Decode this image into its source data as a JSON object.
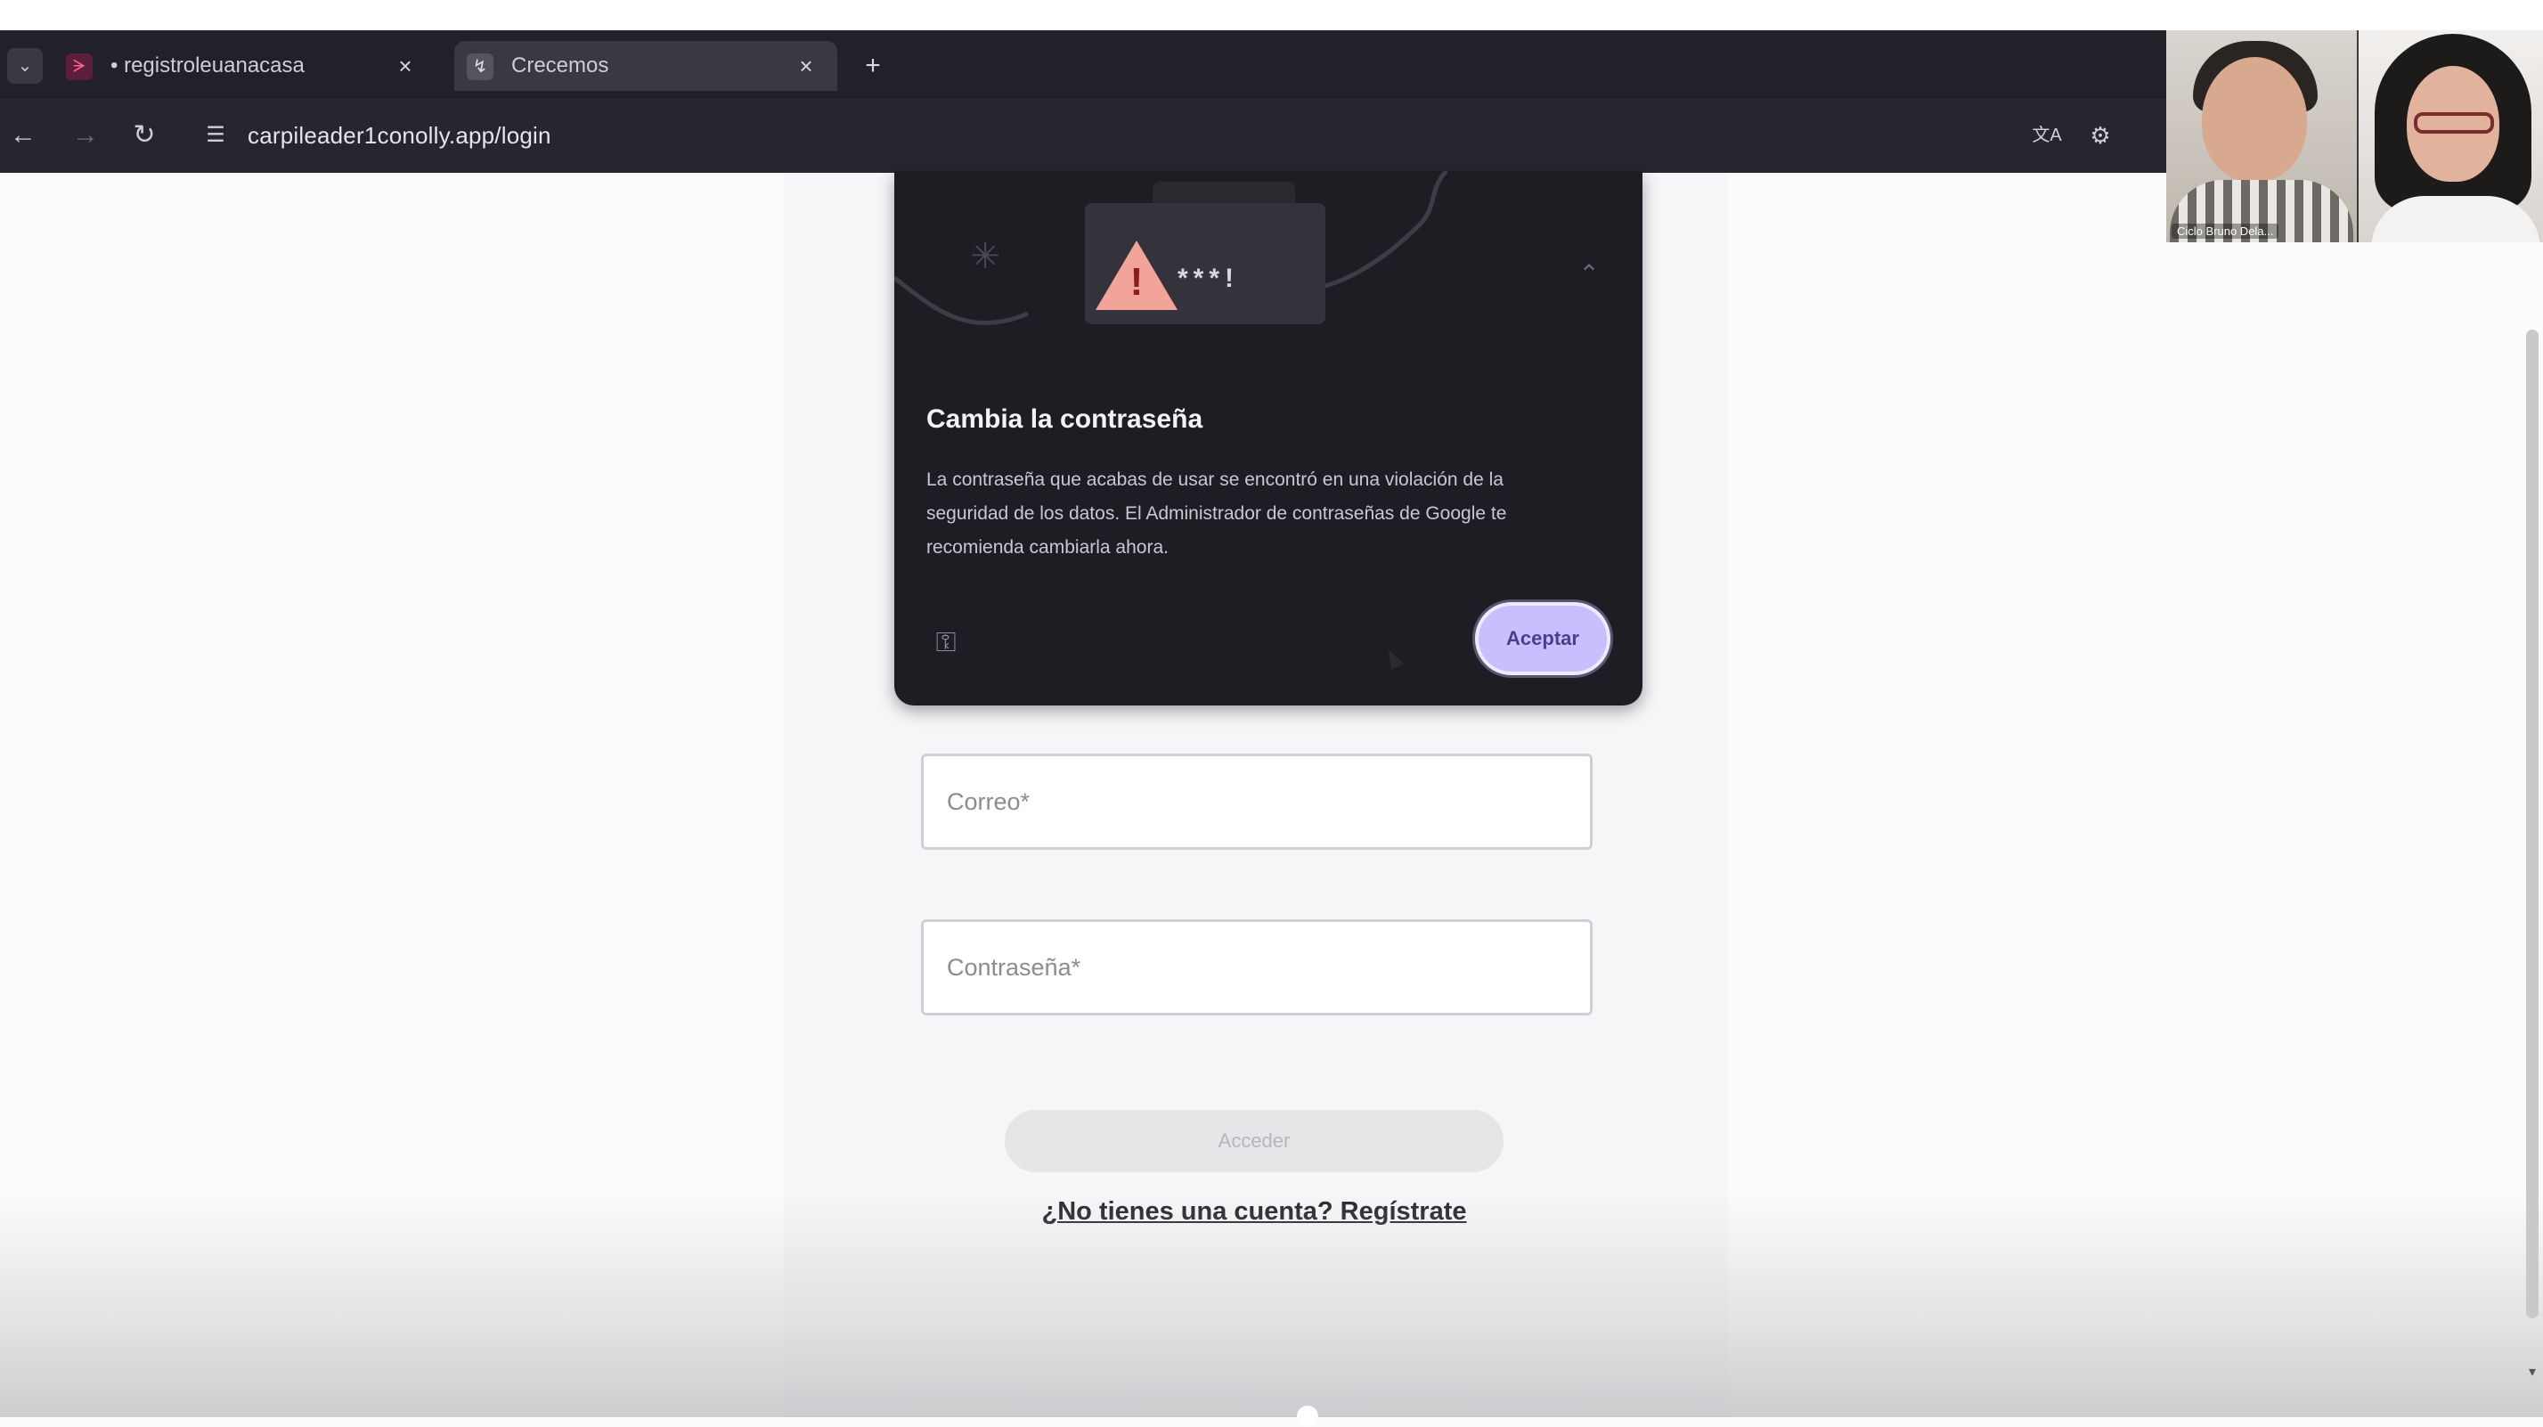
{
  "browser": {
    "tabs": [
      {
        "title": "• registroleuanacasa",
        "active": false
      },
      {
        "title": "Crecemos",
        "active": true
      }
    ],
    "address_bar": {
      "url": "carpileader1conolly.app/login"
    },
    "icons": {
      "tab_list": "chevron-down-icon",
      "tab_close": "close-icon",
      "new_tab": "plus-icon",
      "back": "arrow-left-icon",
      "forward": "arrow-right-icon",
      "reload": "reload-icon",
      "site_info": "tune-icon",
      "translate": "translate-icon",
      "extra": "extension-icon"
    }
  },
  "video_call": {
    "participants": [
      {
        "label": "Ciclo Bruno Dela..."
      },
      {
        "label": ""
      }
    ]
  },
  "password_alert": {
    "title": "Cambia la contraseña",
    "body": "La contraseña que acabas de usar se encontró en una violación de la seguridad de los datos. El Administrador de contraseñas de Google te recomienda cambiarla ahora.",
    "masked_password": "***!",
    "action_label": "Aceptar",
    "icons": {
      "warning": "warning-icon",
      "sparkle": "sparkle-icon",
      "collapse": "chevron-up-icon",
      "footer": "key-icon"
    },
    "colors": {
      "background": "#1f1d24",
      "button": "#c9bfff",
      "warning": "#f2a39a"
    }
  },
  "login_form": {
    "email": {
      "placeholder": "Correo*",
      "value": ""
    },
    "password": {
      "placeholder": "Contraseña*",
      "value": ""
    },
    "submit_label": "Acceder",
    "register_link": "¿No tienes una cuenta? Regístrate"
  }
}
